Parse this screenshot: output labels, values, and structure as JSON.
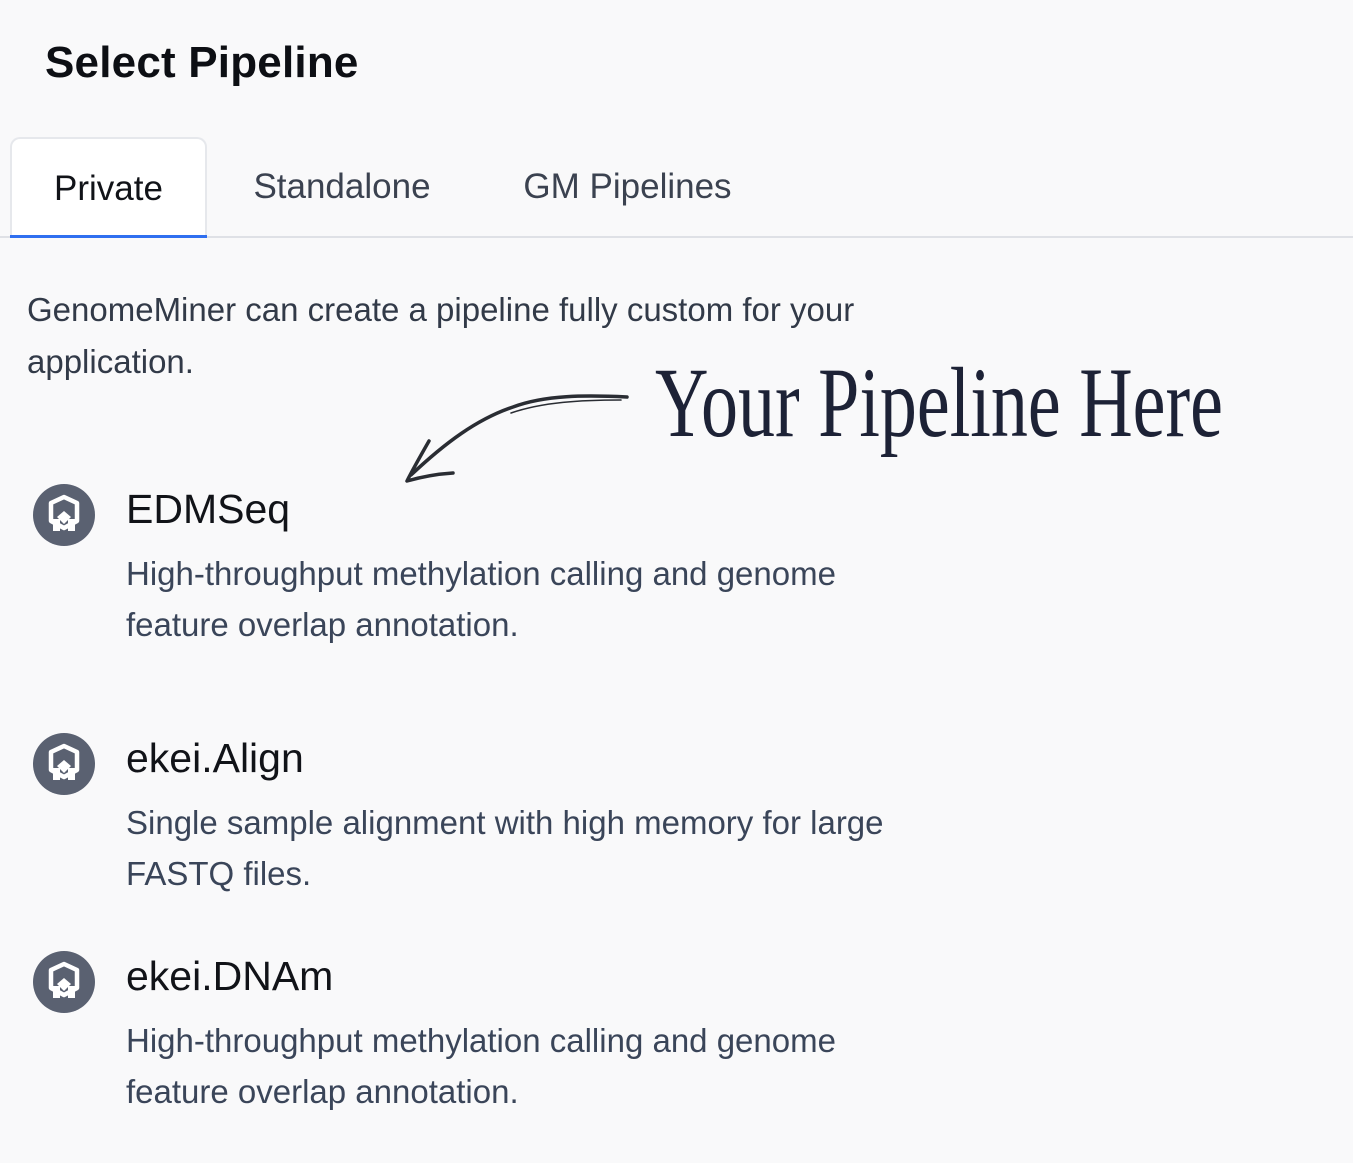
{
  "header": {
    "title": "Select Pipeline"
  },
  "tabs": [
    {
      "label": "Private",
      "active": true
    },
    {
      "label": "Standalone",
      "active": false
    },
    {
      "label": "GM Pipelines",
      "active": false
    }
  ],
  "intro_text": "GenomeMiner can create a pipeline fully custom for your application.",
  "annotation": {
    "text": "Your Pipeline Here",
    "icon": "hand-drawn-arrow-icon"
  },
  "pipelines": [
    {
      "name": "EDMSeq",
      "description": "High-throughput methylation calling and genome feature overlap annotation.",
      "icon": "pipeline-icon"
    },
    {
      "name": "ekei.Align",
      "description": "Single sample alignment with high memory for large FASTQ files.",
      "icon": "pipeline-icon"
    },
    {
      "name": "ekei.DNAm",
      "description": "High-throughput methylation calling and genome feature overlap annotation.",
      "icon": "pipeline-icon"
    }
  ],
  "colors": {
    "background": "#f9f9fa",
    "active_tab_underline": "#2f6ff0",
    "icon_fill": "#5a6171",
    "body_text": "#3a4559"
  }
}
